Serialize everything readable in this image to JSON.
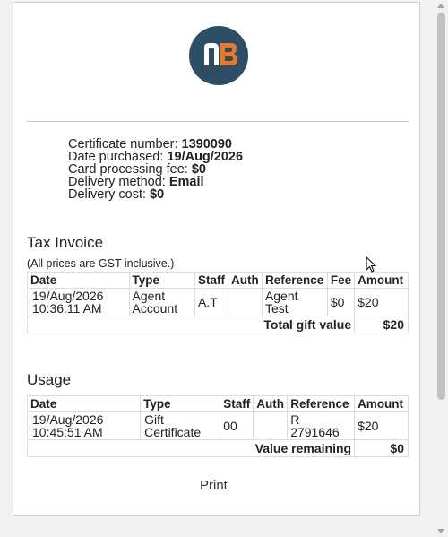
{
  "logo": {
    "text": "nB",
    "bg_color": "#2c4f66",
    "accent_color": "#e8782a"
  },
  "certificate": {
    "number_label": "Certificate number:",
    "number": "1390090",
    "purchased_label": "Date purchased:",
    "purchased": "19/Aug/2026",
    "fee_label": "Card processing fee:",
    "fee": "$0",
    "delivery_method_label": "Delivery method:",
    "delivery_method": "Email",
    "delivery_cost_label": "Delivery cost:",
    "delivery_cost": "$0"
  },
  "tax_invoice": {
    "title": "Tax Invoice",
    "note": "(All prices are GST inclusive.)",
    "headers": [
      "Date",
      "Type",
      "Staff",
      "Auth",
      "Reference",
      "Fee",
      "Amount"
    ],
    "row": {
      "date": "19/Aug/2026",
      "time": "10:36:11 AM",
      "type_line1": "Agent",
      "type_line2": "Account",
      "staff": "A.T",
      "auth": "",
      "ref_line1": "Agent",
      "ref_line2": "Test",
      "fee": "$0",
      "amount": "$20"
    },
    "total_label": "Total gift value",
    "total_value": "$20"
  },
  "usage": {
    "title": "Usage",
    "headers": [
      "Date",
      "Type",
      "Staff",
      "Auth",
      "Reference",
      "Amount"
    ],
    "row": {
      "date": "19/Aug/2026",
      "time": "10:45:51 AM",
      "type_line1": "Gift",
      "type_line2": "Certificate",
      "staff": "00",
      "auth": "",
      "ref_line1": "R",
      "ref_line2": "2791646",
      "amount": "$20"
    },
    "remaining_label": "Value remaining",
    "remaining_value": "$0"
  },
  "print_label": "Print"
}
